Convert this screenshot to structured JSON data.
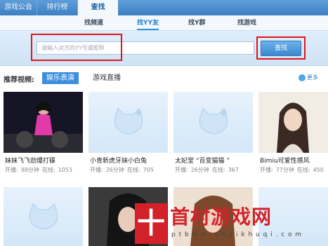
{
  "top_tabs": [
    "游戏公会",
    "排行榜",
    "查找"
  ],
  "sub_tabs": [
    "找频道",
    "找YY友",
    "找Y群",
    "找游戏"
  ],
  "search": {
    "placeholder": "请输入对方的YY号或昵称",
    "button": "查找"
  },
  "recommend": {
    "label": "推荐视频:",
    "tabs": [
      "娱乐表演",
      "游戏直播"
    ],
    "more": "更多"
  },
  "cards": [
    {
      "title": "妹妹飞飞劲爆打碟",
      "meta": [
        "开播:",
        "98分钟",
        "在线:",
        "1053"
      ]
    },
    {
      "title": "小青新虎牙妹小白兔",
      "meta": [
        "开播:",
        "26分钟",
        "在线:",
        "705"
      ]
    },
    {
      "title": "太妃堂 “百变猫猫 ”",
      "meta": [
        "开播:",
        "26分钟",
        "在线:",
        "367"
      ]
    },
    {
      "title": "Bimiu可爱性感风",
      "meta": [
        "开播:",
        "77分钟",
        "在线:",
        "450"
      ]
    }
  ],
  "watermark": {
    "glyph": "十",
    "text": "首村游戏网",
    "url": "p t b w w . s h y i k h u q i . c o m"
  },
  "colors": {
    "accent": "#3d8fdc",
    "highlight": "#e0141b"
  },
  "icons": [
    "more-icon",
    "hello-kitty-placeholder-icon"
  ]
}
